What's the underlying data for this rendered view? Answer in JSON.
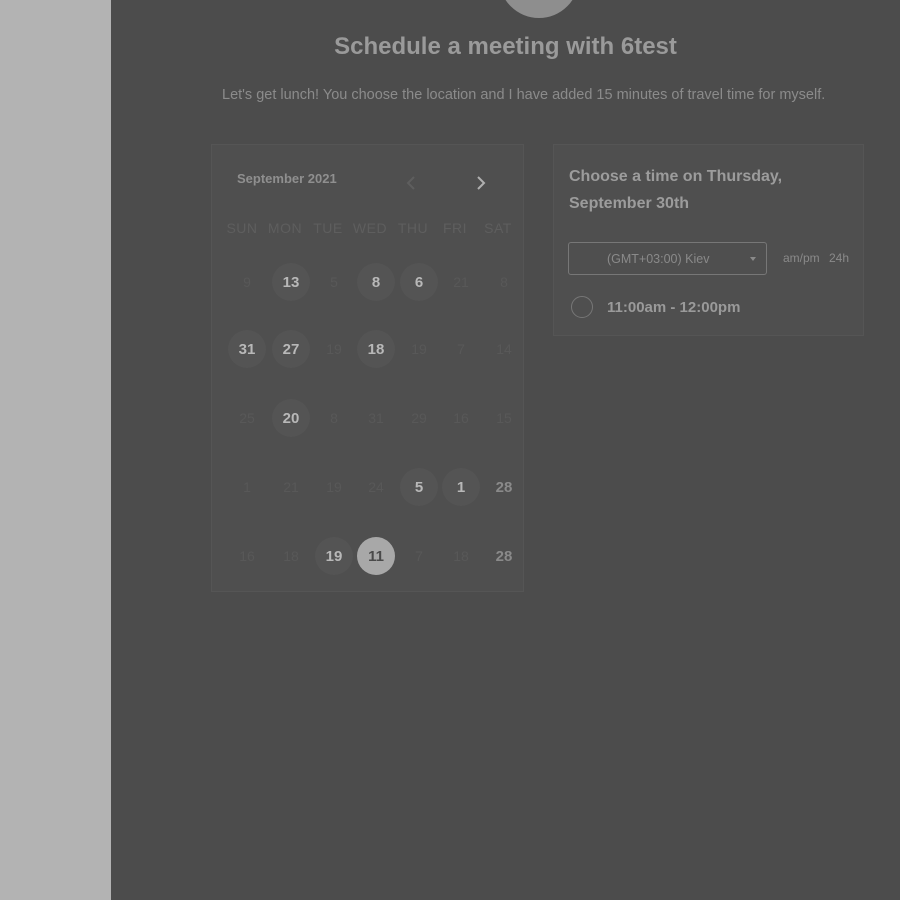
{
  "page": {
    "title": "Schedule a meeting with 6test",
    "subtitle": "Let's get lunch! You choose the location and I have added 15 minutes of travel time for myself."
  },
  "calendar": {
    "month_label": "September 2021",
    "prev_icon": "chevron-left-icon",
    "next_icon": "chevron-right-icon",
    "weekdays": [
      "SUN",
      "MON",
      "TUE",
      "WED",
      "THU",
      "FRI",
      "SAT"
    ],
    "weeks": [
      [
        {
          "label": "9",
          "state": "off"
        },
        {
          "label": "13",
          "state": "avail"
        },
        {
          "label": "5",
          "state": "off"
        },
        {
          "label": "8",
          "state": "avail"
        },
        {
          "label": "6",
          "state": "avail"
        },
        {
          "label": "21",
          "state": "off"
        },
        {
          "label": "8",
          "state": "off"
        }
      ],
      [
        {
          "label": "31",
          "state": "avail"
        },
        {
          "label": "27",
          "state": "avail"
        },
        {
          "label": "19",
          "state": "off"
        },
        {
          "label": "18",
          "state": "avail"
        },
        {
          "label": "19",
          "state": "off"
        },
        {
          "label": "7",
          "state": "off"
        },
        {
          "label": "14",
          "state": "off"
        }
      ],
      [
        {
          "label": "25",
          "state": "off"
        },
        {
          "label": "20",
          "state": "avail"
        },
        {
          "label": "8",
          "state": "off"
        },
        {
          "label": "31",
          "state": "off"
        },
        {
          "label": "29",
          "state": "off"
        },
        {
          "label": "16",
          "state": "off"
        },
        {
          "label": "15",
          "state": "off"
        }
      ],
      [
        {
          "label": "1",
          "state": "off"
        },
        {
          "label": "21",
          "state": "off"
        },
        {
          "label": "19",
          "state": "off"
        },
        {
          "label": "24",
          "state": "off"
        },
        {
          "label": "5",
          "state": "avail"
        },
        {
          "label": "1",
          "state": "avail"
        },
        {
          "label": "28",
          "state": "plain"
        }
      ],
      [
        {
          "label": "16",
          "state": "off"
        },
        {
          "label": "18",
          "state": "off"
        },
        {
          "label": "19",
          "state": "avail"
        },
        {
          "label": "11",
          "state": "selected"
        },
        {
          "label": "7",
          "state": "off"
        },
        {
          "label": "18",
          "state": "off"
        },
        {
          "label": "28",
          "state": "plain"
        }
      ]
    ]
  },
  "times": {
    "heading": "Choose a time on Thursday, September 30th",
    "timezone": "(GMT+03:00) Kiev",
    "format_ampm": "am/pm",
    "format_24": "24h",
    "slots": [
      {
        "label": "11:00am - 12:00pm"
      }
    ]
  },
  "colors": {
    "background": "#4c4c4c",
    "left_strip": "#b3b3b3",
    "selected_day": "#a8a8a8"
  }
}
